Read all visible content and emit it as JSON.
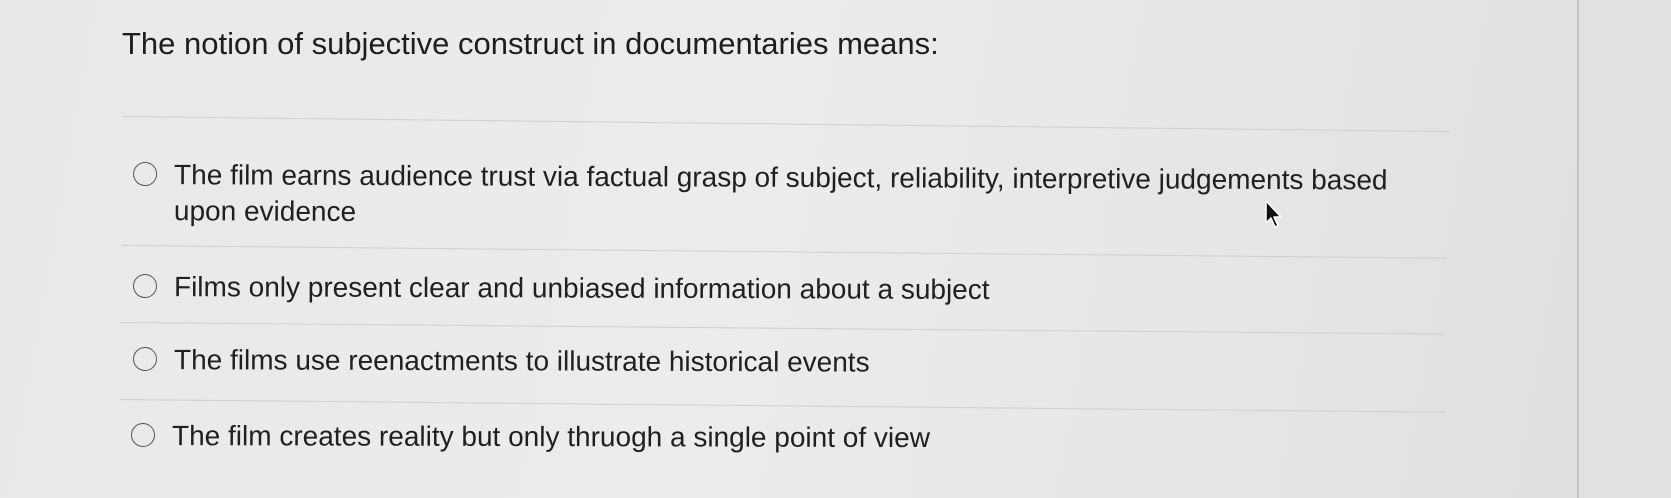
{
  "question": {
    "text": "The notion of subjective construct in documentaries means:"
  },
  "options": [
    {
      "label": "The film earns audience trust via factual grasp of subject, reliability, interpretive judgements based upon evidence",
      "selected": false
    },
    {
      "label": "Films only present clear and unbiased information about a subject",
      "selected": false
    },
    {
      "label": "The films use reenactments to illustrate historical events",
      "selected": false
    },
    {
      "label": "The film creates reality but only thruogh a single point of view",
      "selected": false
    }
  ],
  "icons": {
    "radio": "radio-unselected-icon",
    "cursor": "mouse-pointer-icon"
  }
}
